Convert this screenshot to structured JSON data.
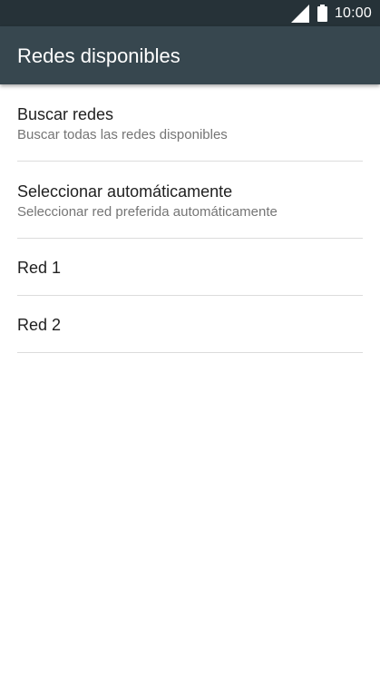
{
  "status_bar": {
    "time": "10:00",
    "icons": [
      "signal-icon",
      "battery-icon"
    ],
    "background": "#263238"
  },
  "app_bar": {
    "title": "Redes disponibles",
    "background": "#37474f"
  },
  "list": {
    "items": [
      {
        "title": "Buscar redes",
        "subtitle": "Buscar todas las redes disponibles"
      },
      {
        "title": "Seleccionar automáticamente",
        "subtitle": "Seleccionar red preferida automáticamente"
      },
      {
        "title": "Red 1"
      },
      {
        "title": "Red 2"
      }
    ]
  }
}
